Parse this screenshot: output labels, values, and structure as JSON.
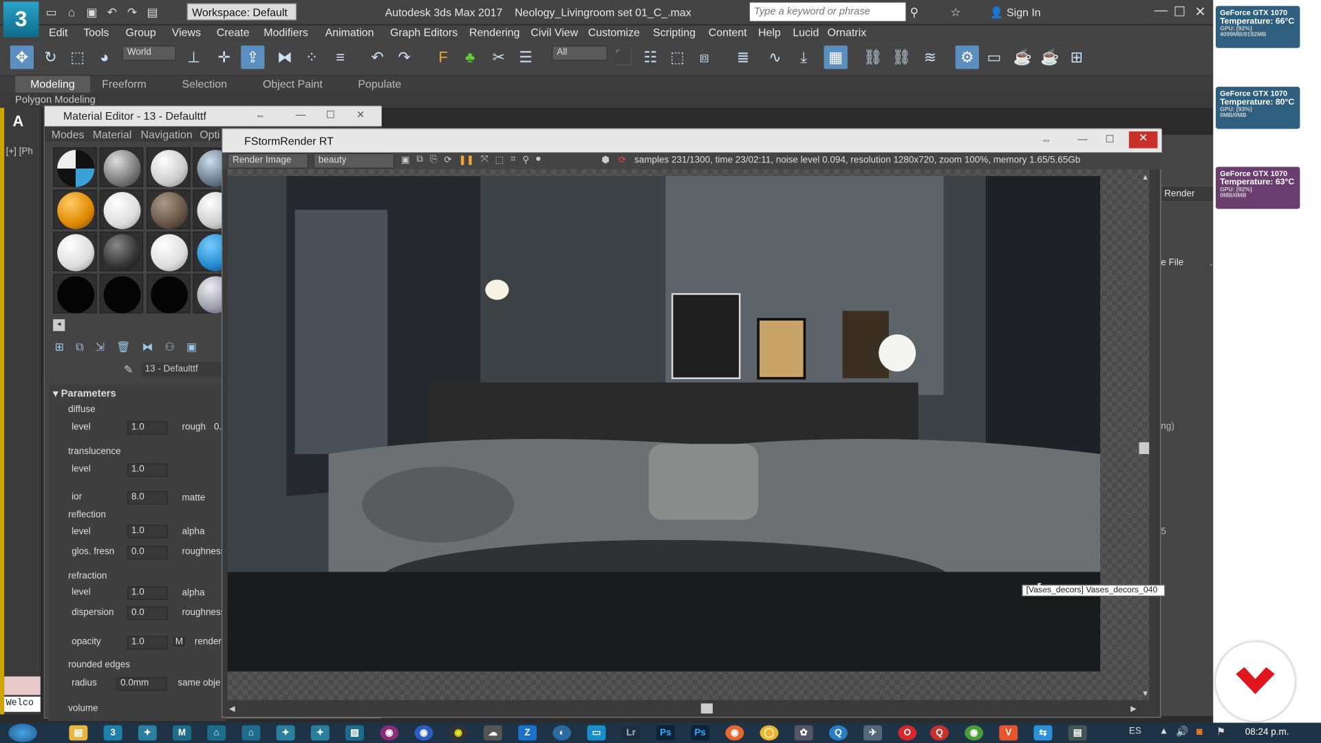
{
  "app": {
    "workspace": "Workspace: Default",
    "title": "Autodesk 3ds Max 2017",
    "file": "Neology_Livingroom set 01_C_.max",
    "search_placeholder": "Type a keyword or phrase",
    "sign_in": "Sign In"
  },
  "menu": [
    "Edit",
    "Tools",
    "Group",
    "Views",
    "Create",
    "Modifiers",
    "Animation",
    "Graph Editors",
    "Rendering",
    "Civil View",
    "Customize",
    "Scripting",
    "Content",
    "Help",
    "Lucid",
    "Ornatrix"
  ],
  "toolbar": {
    "ref_coord": "World",
    "selection_filter": "All"
  },
  "ribbon": {
    "tabs": [
      "Modeling",
      "Freeform",
      "Selection",
      "Object Paint",
      "Populate"
    ],
    "active": "Modeling",
    "sub": "Polygon Modeling"
  },
  "viewport_label": "[+] [Ph",
  "material_editor": {
    "title": "Material Editor - 13 - Defaulttf",
    "menu": [
      "Modes",
      "Material",
      "Navigation",
      "Opti"
    ],
    "material_name": "13 - Defaulttf",
    "rollout": "Parameters",
    "sections": {
      "diffuse": "diffuse",
      "translucence": "translucence",
      "reflection": "reflection",
      "refraction": "refraction",
      "rounded": "rounded edges",
      "volume": "volume"
    },
    "fields": {
      "diff_level_label": "level",
      "diff_level": "1.0",
      "rough_label": "rough",
      "rough_val": "0.",
      "trans_level_label": "level",
      "trans_level": "1.0",
      "ior_label": "ior",
      "ior": "8.0",
      "matte_label": "matte",
      "refl_level_label": "level",
      "refl_level": "1.0",
      "refl_alpha": "alpha",
      "glos_label": "glos. fresn",
      "glos": "0.0",
      "refl_rough": "roughness",
      "refr_level_label": "level",
      "refr_level": "1.0",
      "refr_alpha": "alpha",
      "disp_label": "dispersion",
      "disp": "0.0",
      "refr_rough": "roughness",
      "opacity_label": "opacity",
      "opacity": "1.0",
      "opacity_m": "M",
      "render_label": "render",
      "radius_label": "radius",
      "radius": "0.0mm",
      "same_obj": "same obje"
    }
  },
  "fstorm": {
    "title": "FStormRender RT",
    "mode": "Render Image",
    "pass": "beauty",
    "status": "samples 231/1300,  time 23/02:11,  noise level 0.094,  resolution 1280x720,  zoom 100%,  memory 1.65/5.65Gb"
  },
  "tooltip": "[Vases_decors] Vases_decors_040",
  "right_panel": {
    "render": "Render",
    "file": "e File",
    "dots": "...",
    "ng": "ng)",
    "num": "5"
  },
  "gpus": [
    {
      "name": "GeForce GTX 1070",
      "temp": "Temperature:  66°C",
      "usage": "GPU: [92%]",
      "mem": "4099MB/8192MB"
    },
    {
      "name": "GeForce GTX 1070",
      "temp": "Temperature:  80°C",
      "usage": "GPU: [93%]",
      "mem": "0MB/0MB"
    },
    {
      "name": "GeForce GTX 1070",
      "temp": "Temperature:  63°C",
      "usage": "GPU: [92%]",
      "mem": "0MB/0MB"
    }
  ],
  "welcome": "Welco",
  "taskbar": {
    "lang": "ES",
    "time": "08:24 p.m."
  },
  "colors": {
    "accent": "#5b8fc0",
    "viewport_border": "#cda400",
    "gpu_card": "#3b6a8a"
  }
}
